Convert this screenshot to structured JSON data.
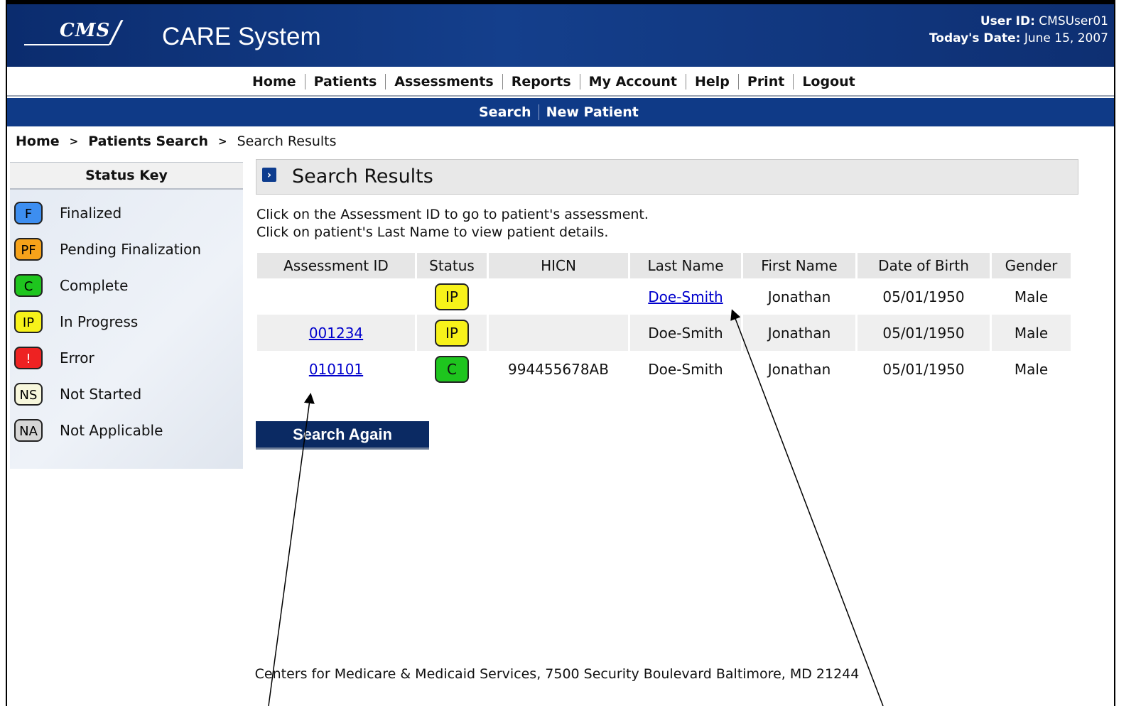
{
  "header": {
    "logo": "CMS",
    "app_title": "CARE System",
    "user_id_label": "User ID:",
    "user_id": "CMSUser01",
    "date_label": "Today's Date:",
    "date": "June 15, 2007"
  },
  "top_nav": [
    "Home",
    "Patients",
    "Assessments",
    "Reports",
    "My Account",
    "Help",
    "Print",
    "Logout"
  ],
  "sub_nav": [
    "Search",
    "New Patient"
  ],
  "breadcrumb": {
    "home": "Home",
    "patients_search": "Patients Search",
    "current": "Search Results",
    "separator": ">"
  },
  "status_key": {
    "title": "Status Key",
    "items": [
      {
        "code": "F",
        "label": "Finalized",
        "color": "#3d8ef0"
      },
      {
        "code": "PF",
        "label": "Pending Finalization",
        "color": "#f6a21a"
      },
      {
        "code": "C",
        "label": "Complete",
        "color": "#1ec51e"
      },
      {
        "code": "IP",
        "label": "In Progress",
        "color": "#f7f21a"
      },
      {
        "code": "!",
        "label": "Error",
        "color": "#ee2222"
      },
      {
        "code": "NS",
        "label": "Not Started",
        "color": "#f7f7dc"
      },
      {
        "code": "NA",
        "label": "Not Applicable",
        "color": "#d6d6d6"
      }
    ]
  },
  "main": {
    "title": "Search Results",
    "instruction_1": "Click on the Assessment ID to go to patient's assessment.",
    "instruction_2": "Click on patient's Last Name to view patient details.",
    "columns": [
      "Assessment ID",
      "Status",
      "HICN",
      "Last Name",
      "First Name",
      "Date of Birth",
      "Gender"
    ],
    "rows": [
      {
        "assessment_id": "",
        "status": "IP",
        "status_color": "#f7f21a",
        "hicn": "",
        "last_name": "Doe-Smith",
        "last_name_link": true,
        "first_name": "Jonathan",
        "dob": "05/01/1950",
        "gender": "Male"
      },
      {
        "assessment_id": "001234",
        "status": "IP",
        "status_color": "#f7f21a",
        "hicn": "",
        "last_name": "Doe-Smith",
        "last_name_link": false,
        "first_name": "Jonathan",
        "dob": "05/01/1950",
        "gender": "Male"
      },
      {
        "assessment_id": "010101",
        "status": "C",
        "status_color": "#1ec51e",
        "hicn": "994455678AB",
        "last_name": "Doe-Smith",
        "last_name_link": false,
        "first_name": "Jonathan",
        "dob": "05/01/1950",
        "gender": "Male"
      }
    ],
    "search_again_label": "Search Again"
  },
  "footer": "Centers for Medicare & Medicaid Services, 7500 Security Boulevard Baltimore, MD 21244",
  "colors": {
    "header_blue": "#143f8c",
    "subnav_blue": "#0f3a87",
    "button_navy": "#0b2a63",
    "link_blue": "#0000cc"
  }
}
